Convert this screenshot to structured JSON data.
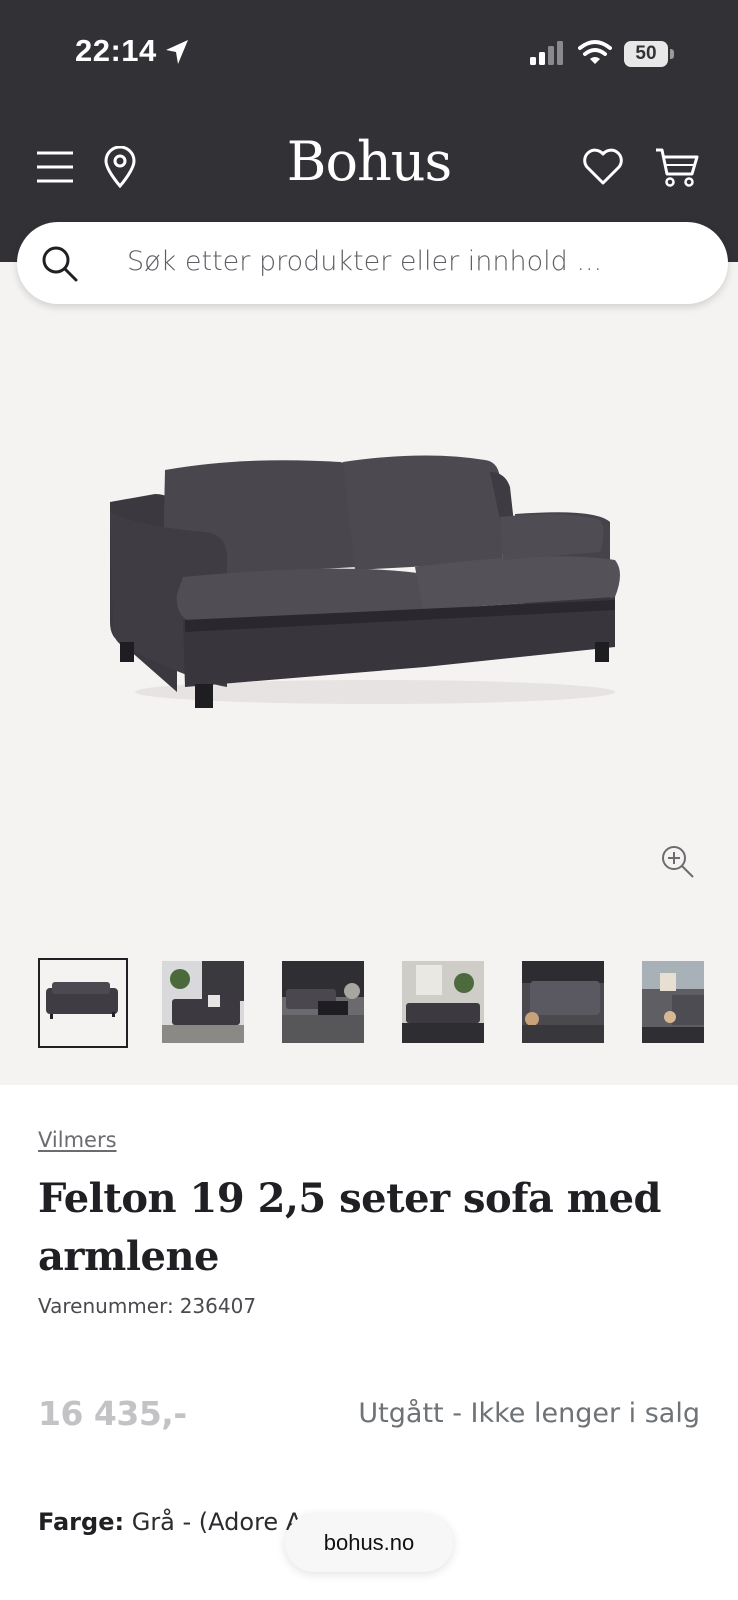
{
  "status_bar": {
    "time": "22:14",
    "battery": "50",
    "icons": [
      "location-arrow-icon",
      "cellular-signal-icon",
      "wifi-icon",
      "battery-icon"
    ]
  },
  "header": {
    "logo": "Bohus",
    "icons": [
      "menu-icon",
      "store-location-icon",
      "wishlist-heart-icon",
      "cart-icon"
    ],
    "background": "#323136"
  },
  "search": {
    "placeholder": "Søk etter produkter eller innhold ..."
  },
  "gallery": {
    "selected_index": 0,
    "thumbnail_count": 6,
    "background": "#f5f3f2"
  },
  "product": {
    "brand": "Vilmers",
    "title": "Felton 19 2,5 seter sofa med armlene",
    "sku_label": "Varenummer:",
    "sku_value": "236407",
    "price": "16 435,-",
    "availability": "Utgått - Ikke lenger i salg",
    "color_label": "Farge:",
    "color_value": "Grå - (Adore A"
  },
  "browser": {
    "url": "bohus.no"
  }
}
